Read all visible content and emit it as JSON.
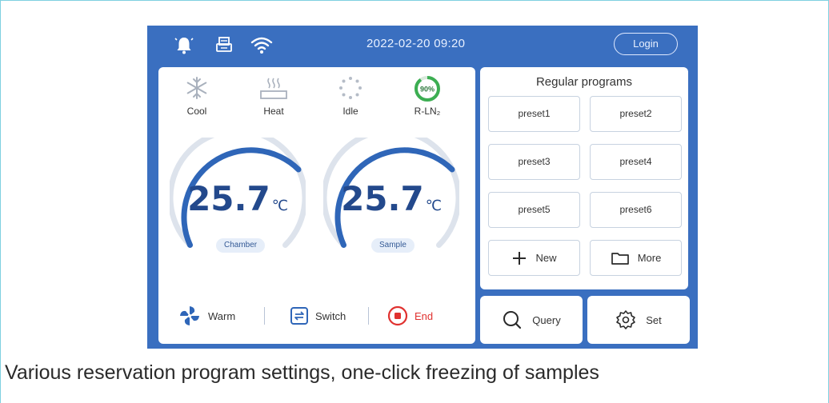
{
  "status_bar": {
    "datetime": "2022-02-20  09:20",
    "login_label": "Login",
    "icons": [
      "bell-icon",
      "printer-icon",
      "wifi-icon"
    ]
  },
  "modes": [
    {
      "label": "Cool",
      "icon": "snowflake-icon"
    },
    {
      "label": "Heat",
      "icon": "heater-icon"
    },
    {
      "label": "Idle",
      "icon": "idle-spinner-icon"
    },
    {
      "label": "R-LN₂",
      "icon": "ring-progress-icon",
      "level_text": "90%",
      "level": 0.9
    }
  ],
  "gauges": [
    {
      "value": "25.7",
      "unit": "℃",
      "label": "Chamber"
    },
    {
      "value": "25.7",
      "unit": "℃",
      "label": "Sample"
    }
  ],
  "controls": {
    "warm_label": "Warm",
    "switch_label": "Switch",
    "end_label": "End"
  },
  "programs": {
    "title": "Regular programs",
    "presets": [
      "preset1",
      "preset2",
      "preset3",
      "preset4",
      "preset5",
      "preset6"
    ],
    "new_label": "New",
    "more_label": "More"
  },
  "bottom_buttons": {
    "query_label": "Query",
    "set_label": "Set"
  },
  "caption": "Various reservation program settings,  one-click freezing of samples",
  "colors": {
    "screen_bg": "#3a6fc0",
    "gauge_arc": "#2f66b8",
    "gauge_track": "#dde3ec",
    "end_red": "#e0312f",
    "ring_green": "#3cae52"
  }
}
